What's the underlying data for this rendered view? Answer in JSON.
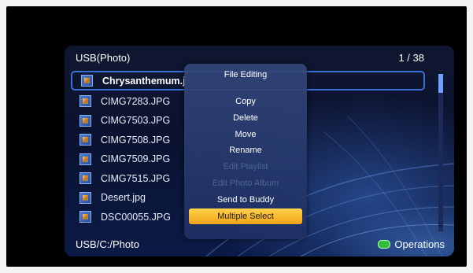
{
  "header": {
    "title": "USB(Photo)",
    "page_count": "1 / 38"
  },
  "files": [
    {
      "name": "Chrysanthemum.j",
      "selected": true
    },
    {
      "name": "CIMG7283.JPG"
    },
    {
      "name": "CIMG7503.JPG"
    },
    {
      "name": "CIMG7508.JPG"
    },
    {
      "name": "CIMG7509.JPG"
    },
    {
      "name": "CIMG7515.JPG"
    },
    {
      "name": "Desert.jpg"
    },
    {
      "name": "DSC00055.JPG"
    }
  ],
  "file_icon": "image-file-icon",
  "footer": {
    "path": "USB/C:/Photo",
    "operations_label": "Operations",
    "operations_icon": "green-button-icon",
    "operations_color": "#2fbf3a"
  },
  "menu": {
    "title": "File Editing",
    "items": [
      {
        "label": "Copy",
        "enabled": true
      },
      {
        "label": "Delete",
        "enabled": true
      },
      {
        "label": "Move",
        "enabled": true
      },
      {
        "label": "Rename",
        "enabled": true
      },
      {
        "label": "Edit Playlist",
        "enabled": false
      },
      {
        "label": "Edit Photo Album",
        "enabled": false
      },
      {
        "label": "Send to Buddy",
        "enabled": true
      },
      {
        "label": "Multiple Select",
        "enabled": true,
        "highlighted": true
      }
    ],
    "highlight_color": "#f5b82a"
  },
  "colors": {
    "selection_border": "#3a6fd8",
    "scroll_thumb": "#6fa0ff"
  }
}
